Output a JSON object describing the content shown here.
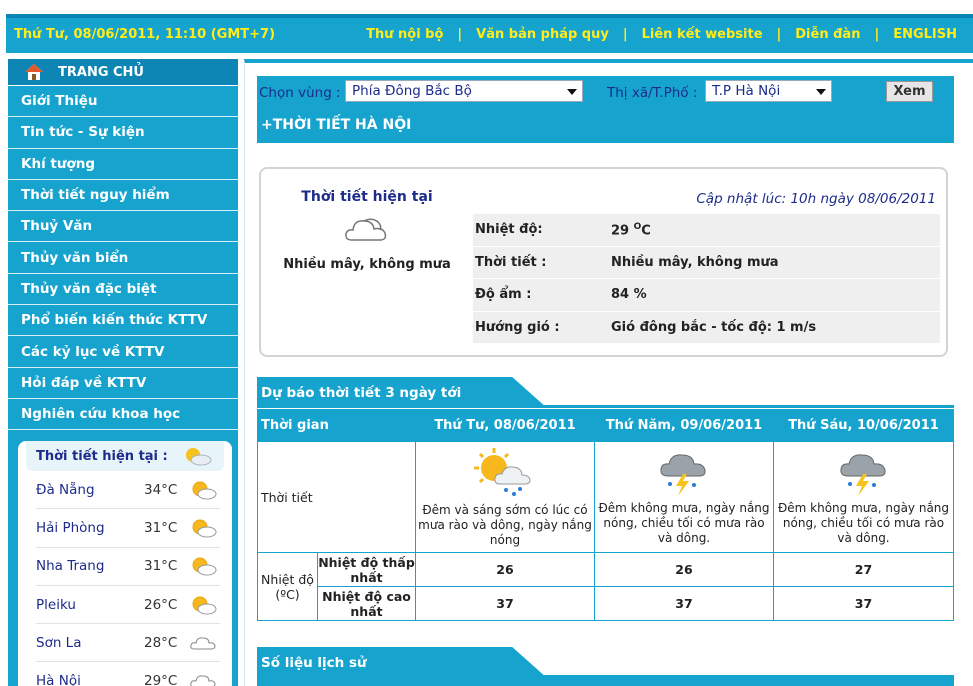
{
  "topbar": {
    "datetime": "Thứ Tư, 08/06/2011, 11:10 (GMT+7)",
    "nav": [
      "Thư nội bộ",
      "Văn bản pháp quy",
      "Liên kết website",
      "Diễn đàn",
      "ENGLISH"
    ]
  },
  "sidebar": {
    "home": "TRANG CHỦ",
    "items": [
      "Giới Thiệu",
      "Tin tức - Sự kiện",
      "Khí tượng",
      "Thời tiết nguy hiểm",
      "Thuỷ Văn",
      "Thủy văn biển",
      "Thủy văn đặc biệt",
      "Phổ biến kiến thức KTTV",
      "Các kỷ lục về KTTV",
      "Hỏi đáp về KTTV",
      "Nghiên cứu khoa học"
    ],
    "weather_title": "Thời tiết hiện tại :",
    "cities": [
      {
        "name": "Đà Nẵng",
        "temp": "34°C",
        "icon": "sun-cloud-icon"
      },
      {
        "name": "Hải Phòng",
        "temp": "31°C",
        "icon": "sun-cloud-icon"
      },
      {
        "name": "Nha Trang",
        "temp": "31°C",
        "icon": "sun-cloud-icon"
      },
      {
        "name": "Pleiku",
        "temp": "26°C",
        "icon": "sun-cloud-icon"
      },
      {
        "name": "Sơn La",
        "temp": "28°C",
        "icon": "cloud-icon"
      },
      {
        "name": "Hà Nội",
        "temp": "29°C",
        "icon": "cloud-icon"
      }
    ]
  },
  "selector": {
    "region_label": "Chọn vùng :",
    "region_value": "Phía Đông Bắc Bộ",
    "city_label": "Thị xã/T.Phố :",
    "city_value": "T.P Hà Nội",
    "button": "Xem",
    "title": "+THỜI TIẾT  HÀ NỘI"
  },
  "current": {
    "title": "Thời tiết hiện tại",
    "condition": "Nhiều mây, không mưa",
    "updated": "Cập nhật lúc: 10h ngày 08/06/2011",
    "rows": [
      {
        "label": "Nhiệt độ:",
        "value": "29",
        "unit": "O",
        "unit_suffix": "C"
      },
      {
        "label": "Thời tiết :",
        "value": "Nhiều mây, không mưa"
      },
      {
        "label": "Độ ẩm :",
        "value": "84 %"
      },
      {
        "label": "Hướng gió :",
        "value": "Gió đông bắc - tốc độ: 1 m/s"
      }
    ]
  },
  "forecast": {
    "section_title": "Dự báo thời tiết 3 ngày tới",
    "col_time": "Thời gian",
    "days": [
      "Thứ Tư, 08/06/2011",
      "Thứ Năm, 09/06/2011",
      "Thứ Sáu, 10/06/2011"
    ],
    "row_weather": "Thời tiết",
    "descriptions": [
      "Đêm và sáng sớm có lúc có mưa rào và dông, ngày nắng nóng",
      "Đêm không mưa, ngày nắng nóng, chiều tối có mưa rào và dông.",
      "Đêm không mưa, ngày nắng nóng, chiều tối có mưa rào và dông."
    ],
    "row_temp": "Nhiệt độ (ºC)",
    "low_label": "Nhiệt độ thấp nhất",
    "high_label": "Nhiệt độ cao nhất",
    "low": [
      "26",
      "26",
      "27"
    ],
    "high": [
      "37",
      "37",
      "37"
    ]
  },
  "history": {
    "section_title": "Số liệu lịch sử"
  },
  "colors": {
    "primary": "#16a4cf",
    "dark": "#0d85b5",
    "nav_text": "#ffec1a",
    "link": "#1d2c8a"
  }
}
